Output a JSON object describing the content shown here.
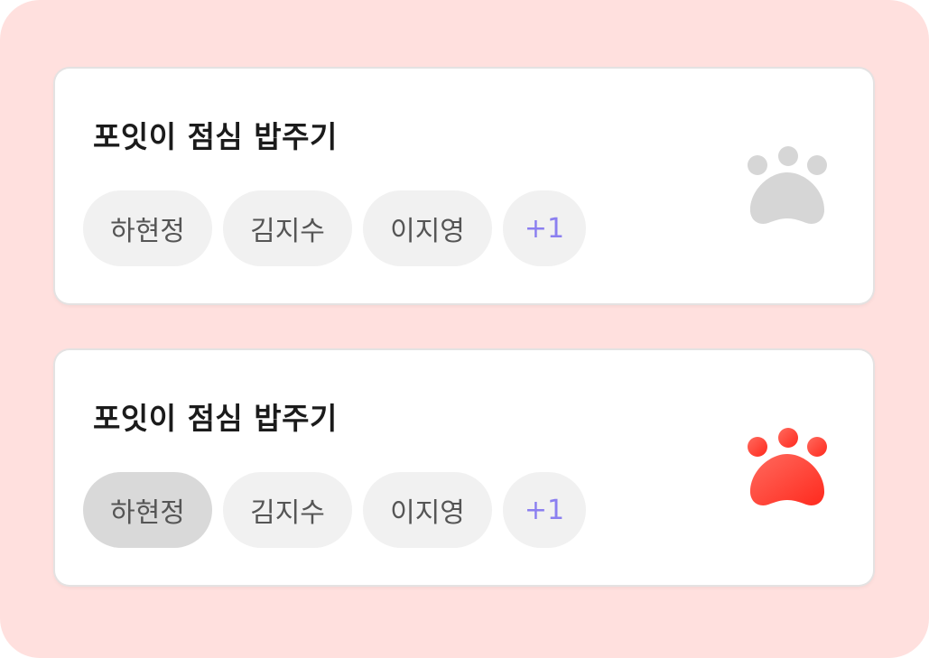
{
  "cards": [
    {
      "title": "포잇이 점심 밥주기",
      "members": [
        "하현정",
        "김지수",
        "이지영"
      ],
      "more_label": "+1",
      "paw_icon": "paw-icon",
      "paw_state": "inactive",
      "paw_color": "#d6d6d6"
    },
    {
      "title": "포잇이 점심 밥주기",
      "members": [
        "하현정",
        "김지수",
        "이지영"
      ],
      "more_label": "+1",
      "paw_icon": "paw-icon",
      "paw_state": "active",
      "paw_color": "#ff3b30",
      "selected_member": "하현정"
    }
  ],
  "colors": {
    "background": "#ffe0de",
    "card": "#ffffff",
    "chip": "#f1f1f1",
    "chip_selected": "#d9d9d9",
    "more_text": "#8b7ff0",
    "paw_inactive": "#d6d6d6",
    "paw_active": "#ff3b30"
  }
}
